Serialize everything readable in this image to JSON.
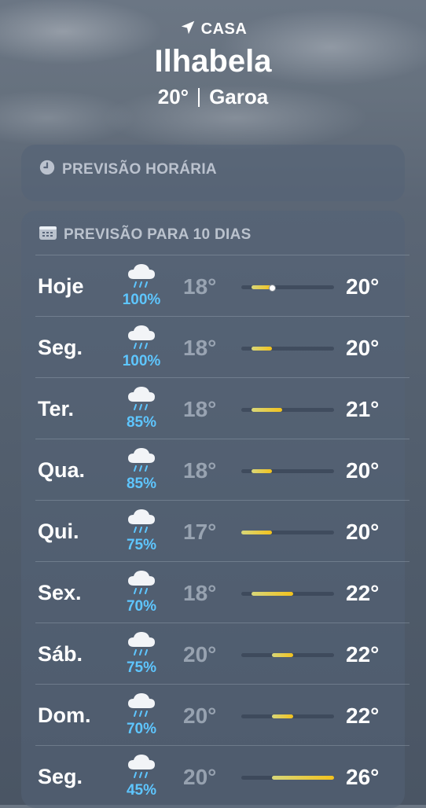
{
  "header": {
    "location_label": "CASA",
    "location_icon": "location-arrow-icon",
    "city": "Ilhabela",
    "temperature": "20°",
    "condition": "Garoa"
  },
  "hourly": {
    "title": "PREVISÃO HORÁRIA",
    "icon": "clock-icon"
  },
  "ten_day": {
    "title": "PREVISÃO PARA 10 DIAS",
    "icon": "calendar-icon",
    "range_min": 17,
    "range_max": 26,
    "current_temp": 20,
    "rows": [
      {
        "day": "Hoje",
        "icon": "rain-cloud-icon",
        "pop": "100%",
        "low": "18°",
        "high": "20°",
        "low_val": 18,
        "high_val": 20,
        "current": true
      },
      {
        "day": "Seg.",
        "icon": "rain-cloud-icon",
        "pop": "100%",
        "low": "18°",
        "high": "20°",
        "low_val": 18,
        "high_val": 20
      },
      {
        "day": "Ter.",
        "icon": "rain-cloud-icon",
        "pop": "85%",
        "low": "18°",
        "high": "21°",
        "low_val": 18,
        "high_val": 21
      },
      {
        "day": "Qua.",
        "icon": "rain-cloud-icon",
        "pop": "85%",
        "low": "18°",
        "high": "20°",
        "low_val": 18,
        "high_val": 20
      },
      {
        "day": "Qui.",
        "icon": "rain-cloud-icon",
        "pop": "75%",
        "low": "17°",
        "high": "20°",
        "low_val": 17,
        "high_val": 20
      },
      {
        "day": "Sex.",
        "icon": "rain-cloud-icon",
        "pop": "70%",
        "low": "18°",
        "high": "22°",
        "low_val": 18,
        "high_val": 22
      },
      {
        "day": "Sáb.",
        "icon": "rain-cloud-icon",
        "pop": "75%",
        "low": "20°",
        "high": "22°",
        "low_val": 20,
        "high_val": 22
      },
      {
        "day": "Dom.",
        "icon": "rain-cloud-icon",
        "pop": "70%",
        "low": "20°",
        "high": "22°",
        "low_val": 20,
        "high_val": 22
      },
      {
        "day": "Seg.",
        "icon": "rain-cloud-icon",
        "pop": "45%",
        "low": "20°",
        "high": "26°",
        "low_val": 20,
        "high_val": 26
      }
    ]
  },
  "colors": {
    "pop_blue": "#5ec6ff",
    "bar_yellow": "#f3c21c",
    "bar_green_yellow": "#d8d77a"
  }
}
